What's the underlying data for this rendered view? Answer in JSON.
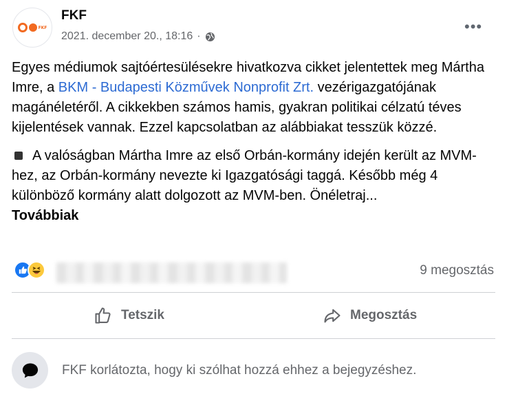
{
  "post": {
    "author": "FKF",
    "logo_text": "FKF",
    "timestamp": "2021. december 20., 18:16",
    "separator": "·",
    "privacy_icon": "globe-icon",
    "more_options": "•••",
    "paragraph1": {
      "before_link": "Egyes médiumok sajtóértesülésekre hivatkozva cikket jelentettek meg Mártha Imre, a ",
      "link": "BKM - Budapesti Közművek Nonprofit Zrt.",
      "after_link": " vezérigazgatójának  magánéletéről. A cikkekben számos hamis, gyakran politikai célzatú téves kijelentések vannak. Ezzel kapcsolatban az alábbiakat tesszük közzé."
    },
    "paragraph2": "A valóságban Mártha Imre az első Orbán-kormány idején került az MVM-hez, az Orbán-kormány nevezte ki Igazgatósági taggá. Később még 4 különböző kormány alatt dolgozott az MVM-ben. Önéletraj...",
    "see_more": "Továbbiak"
  },
  "stats": {
    "reactions": [
      "like",
      "haha"
    ],
    "shares": "9 megosztás"
  },
  "actions": {
    "like": "Tetszik",
    "share": "Megosztás"
  },
  "comments": {
    "restricted_text": "FKF korlátozta, hogy ki szólhat hozzá ehhez a bejegyzéshez."
  },
  "colors": {
    "link": "#2d6bd3",
    "secondary_text": "#65676b",
    "like_blue": "#1877f2",
    "haha_yellow": "#fcc93c",
    "brand_orange": "#f26a21"
  }
}
